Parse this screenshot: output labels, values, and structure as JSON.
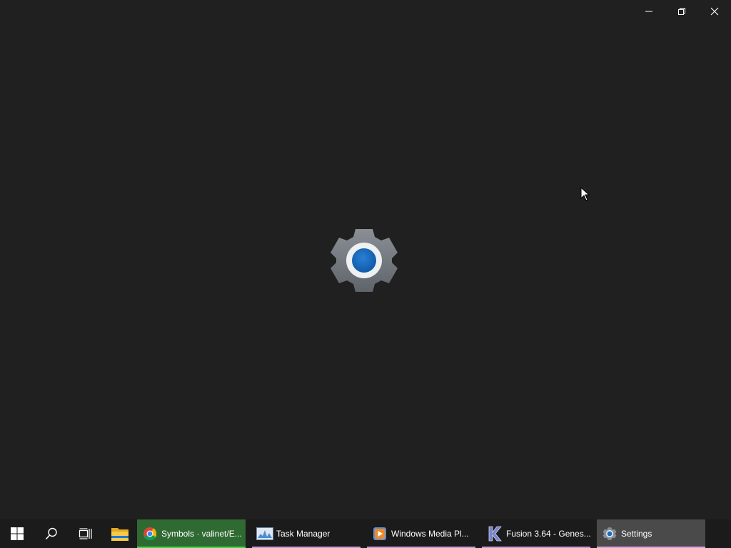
{
  "window": {
    "caption_buttons": [
      {
        "name": "minimize-icon"
      },
      {
        "name": "restore-icon"
      },
      {
        "name": "close-icon"
      }
    ],
    "splash_icon": "settings-gear-icon",
    "accent_color": "#0f6cbd"
  },
  "taskbar": {
    "system_buttons": [
      {
        "name": "windows-start-icon"
      },
      {
        "name": "search-icon"
      },
      {
        "name": "task-view-icon"
      },
      {
        "name": "file-explorer-icon"
      }
    ],
    "apps": [
      {
        "label": "Symbols · valinet/E...",
        "icon": "chrome-icon",
        "state": "active"
      },
      {
        "label": "Task Manager",
        "icon": "task-manager-icon",
        "state": "open"
      },
      {
        "label": "Windows Media Pl...",
        "icon": "windows-media-player-icon",
        "state": "open"
      },
      {
        "label": "Fusion 3.64 - Genes...",
        "icon": "kega-fusion-icon",
        "state": "open"
      },
      {
        "label": "Settings",
        "icon": "settings-icon",
        "state": "focused"
      }
    ],
    "colors": {
      "chrome_active_bg": "#2f6a33",
      "chrome_underline": "#48d248",
      "open_underline": "#c79bcf",
      "settings_bg": "#4a4a4a"
    }
  }
}
